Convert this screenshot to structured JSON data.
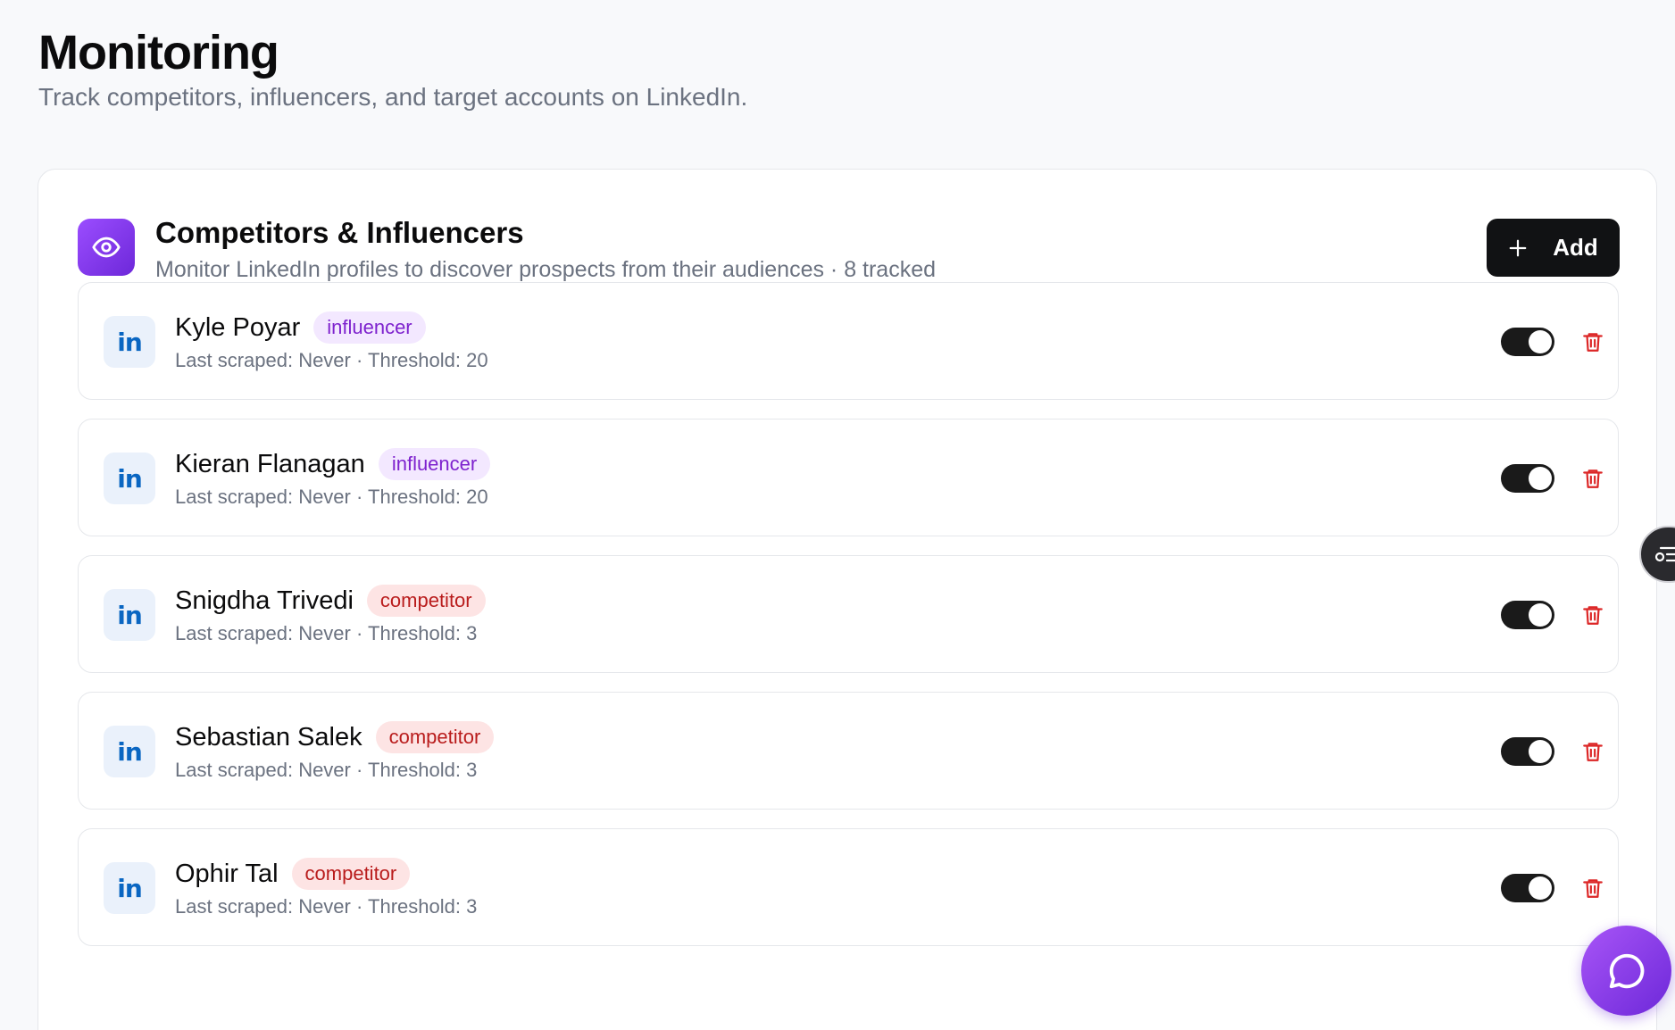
{
  "page": {
    "title": "Monitoring",
    "subtitle": "Track competitors, influencers, and target accounts on LinkedIn."
  },
  "section": {
    "icon": "eye-icon",
    "title": "Competitors & Influencers",
    "subtitle": "Monitor LinkedIn profiles to discover prospects from their audiences · 8 tracked",
    "add_label": "Add",
    "add_icon": "plus-icon"
  },
  "profiles": [
    {
      "name": "Kyle Poyar",
      "tag": "influencer",
      "meta": "Last scraped: Never · Threshold: 20",
      "enabled": true
    },
    {
      "name": "Kieran Flanagan",
      "tag": "influencer",
      "meta": "Last scraped: Never · Threshold: 20",
      "enabled": true
    },
    {
      "name": "Snigdha Trivedi",
      "tag": "competitor",
      "meta": "Last scraped: Never · Threshold: 3",
      "enabled": true
    },
    {
      "name": "Sebastian Salek",
      "tag": "competitor",
      "meta": "Last scraped: Never · Threshold: 3",
      "enabled": true
    },
    {
      "name": "Ophir Tal",
      "tag": "competitor",
      "meta": "Last scraped: Never · Threshold: 3",
      "enabled": true
    }
  ],
  "row_icons": {
    "logo": "linkedin-icon",
    "delete": "trash-icon"
  },
  "widgets": {
    "chat": "chat-bubble-icon",
    "side_panel": "contact-list-icon"
  },
  "colors": {
    "accent_purple": "#7c3aed",
    "influencer_bg": "#f3e8ff",
    "influencer_text": "#7e22ce",
    "competitor_bg": "#fde4e4",
    "competitor_text": "#b91c1c",
    "linkedin_blue": "#0a66c2",
    "delete_red": "#dc2626",
    "toggle_on": "#1a1a1a"
  }
}
